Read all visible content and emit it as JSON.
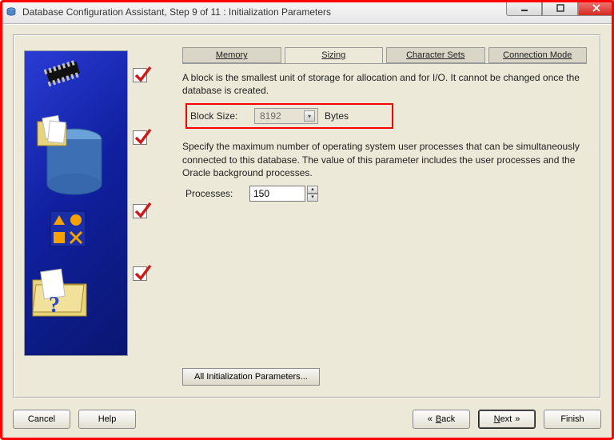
{
  "window": {
    "title": "Database Configuration Assistant, Step 9 of 11 : Initialization Parameters"
  },
  "tabs": {
    "memory": "Memory",
    "sizing": "Sizing",
    "charsets": "Character Sets",
    "connmode": "Connection Mode"
  },
  "text": {
    "block_desc": "A block is the smallest unit of storage for allocation and for I/O. It cannot be changed once the database is created.",
    "block_size_label": "Block Size:",
    "block_size_unit": "Bytes",
    "proc_desc": "Specify the maximum number of operating system user processes that can be simultaneously connected to this database. The value of this parameter includes the user processes and the Oracle background processes.",
    "processes_label": "Processes:"
  },
  "values": {
    "block_size": "8192",
    "processes": "150"
  },
  "buttons": {
    "all_params": "All Initialization Parameters...",
    "cancel": "Cancel",
    "help": "Help",
    "back_prefix": "B",
    "back_rest": "ack",
    "next_prefix": "N",
    "next_rest": "ext",
    "finish": "Finish"
  }
}
